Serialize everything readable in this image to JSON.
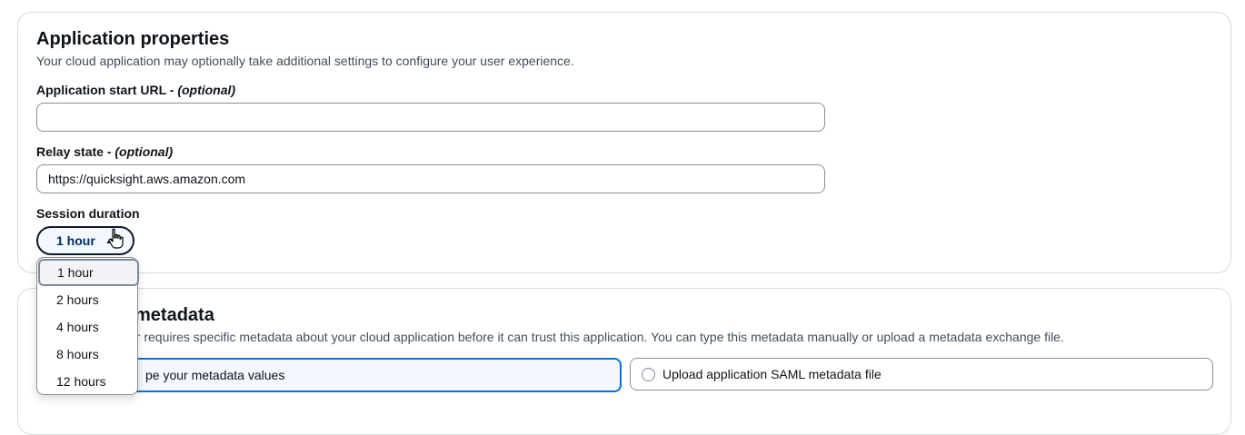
{
  "app_properties": {
    "title": "Application properties",
    "description": "Your cloud application may optionally take additional settings to configure your user experience.",
    "start_url": {
      "label": "Application start URL - ",
      "optional": "(optional)",
      "value": ""
    },
    "relay_state": {
      "label": "Relay state - ",
      "optional": "(optional)",
      "value": "https://quicksight.aws.amazon.com"
    },
    "session_duration": {
      "label": "Session duration",
      "selected": "1 hour",
      "options": [
        "1 hour",
        "2 hours",
        "4 hours",
        "8 hours",
        "12 hours"
      ]
    }
  },
  "metadata": {
    "title_visible": "metadata",
    "description_visible": "er requires specific metadata about your cloud application before it can trust this application. You can type this metadata manually or upload a metadata exchange file.",
    "option_manual_visible": "pe your metadata values",
    "option_upload": "Upload application SAML metadata file"
  },
  "colors": {
    "border": "#d5dbdb",
    "accent": "#0972d3",
    "select_text": "#002b66"
  }
}
